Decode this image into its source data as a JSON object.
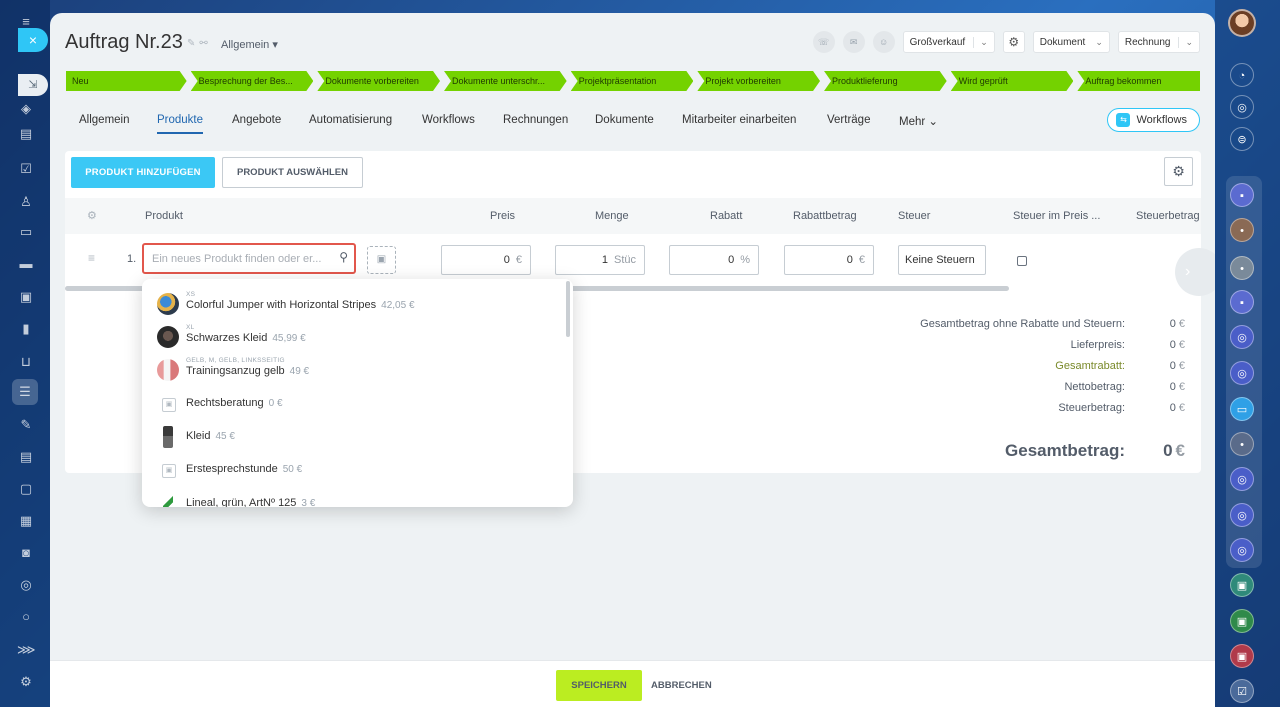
{
  "header": {
    "title": "Auftrag Nr.23",
    "category": "Allgemein",
    "category_caret": "▾",
    "select_deal_type": "Großverkauf",
    "select_document": "Dokument",
    "select_invoice": "Rechnung"
  },
  "stages": [
    "Neu",
    "Besprechung der Bes...",
    "Dokumente vorbereiten",
    "Dokumente unterschr...",
    "Projektpräsentation",
    "Projekt vorbereiten",
    "Produktlieferung",
    "Wird geprüft",
    "Auftrag bekommen"
  ],
  "tabs": [
    "Allgemein",
    "Produkte",
    "Angebote",
    "Automatisierung",
    "Workflows",
    "Rechnungen",
    "Dokumente",
    "Mitarbeiter einarbeiten",
    "Verträge",
    "Mehr"
  ],
  "tabs_more_caret": "⌄",
  "active_tab": "Produkte",
  "workflows_button": "Workflows",
  "toolbar": {
    "add_product": "PRODUKT HINZUFÜGEN",
    "choose_product": "PRODUKT AUSWÄHLEN"
  },
  "table": {
    "columns": [
      "Produkt",
      "Preis",
      "Menge",
      "Rabatt",
      "Rabattbetrag",
      "Steuer",
      "Steuer im Preis ...",
      "Steuerbetrag"
    ],
    "row": {
      "number": "1.",
      "search_placeholder": "Ein neues Produkt finden oder er...",
      "price": "0",
      "price_unit": "€",
      "quantity": "1",
      "quantity_unit": "Stüc",
      "discount": "0",
      "discount_unit": "%",
      "discount_amount": "0",
      "discount_amount_unit": "€",
      "tax": "Keine Steuern"
    }
  },
  "totals": [
    {
      "label": "Gesamtbetrag ohne Rabatte und Steuern:",
      "value": "0",
      "currency": "€"
    },
    {
      "label": "Lieferpreis:",
      "value": "0",
      "currency": "€"
    },
    {
      "label": "Gesamtrabatt:",
      "value": "0",
      "currency": "€"
    },
    {
      "label": "Nettobetrag:",
      "value": "0",
      "currency": "€"
    },
    {
      "label": "Steuerbetrag:",
      "value": "0",
      "currency": "€"
    }
  ],
  "grand_total": {
    "label": "Gesamtbetrag:",
    "value": "0",
    "currency": "€"
  },
  "dropdown_items": [
    {
      "tag": "XS",
      "name": "Colorful Jumper with Horizontal Stripes",
      "price": "42,05 €"
    },
    {
      "tag": "XL",
      "name": "Schwarzes Kleid",
      "price": "45,99 €"
    },
    {
      "tag": "GELB, M, GELB, LINKSSEITIG",
      "name": "Trainingsanzug gelb",
      "price": "49 €"
    },
    {
      "tag": "",
      "name": "Rechtsberatung",
      "price": "0 €"
    },
    {
      "tag": "",
      "name": "Kleid",
      "price": "45 €"
    },
    {
      "tag": "",
      "name": "Erstesprechstunde",
      "price": "50 €"
    },
    {
      "tag": "",
      "name": "Lineal, grün, ArtNº 125",
      "price": "3 €"
    }
  ],
  "bottom": {
    "save": "SPEICHERN",
    "cancel": "ABBRECHEN"
  },
  "colors": {
    "stage": "#74d200",
    "accent_blue": "#3bc8f5",
    "save_green": "#bbed21",
    "active_tab": "#2067b0",
    "search_border": "#e2574c"
  },
  "icons": {
    "close": "×",
    "gear": "⚙",
    "search": "⌕",
    "drag": "≡",
    "image": "▣",
    "arrow_right": "›"
  }
}
